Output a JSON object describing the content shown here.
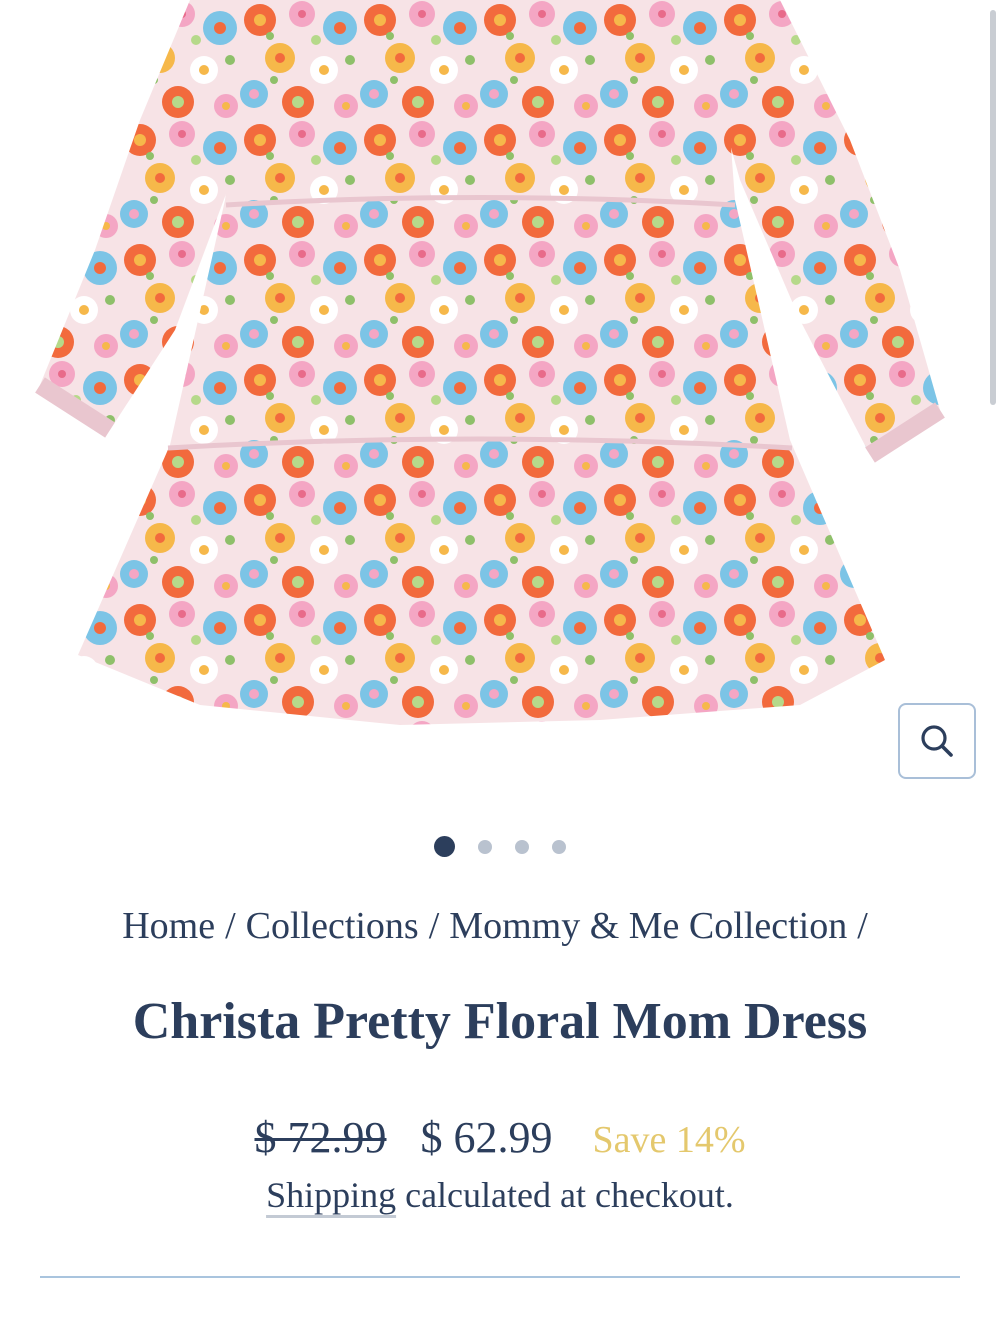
{
  "product": {
    "image_alt": "Christa Pretty Floral Mom Dress",
    "title": "Christa Pretty Floral Mom Dress",
    "price_compare": "$ 72.99",
    "price_sale": "$ 62.99",
    "save_label": "Save 14%"
  },
  "gallery": {
    "zoom_icon": "search-icon",
    "slide_count": 4,
    "active_slide": 1
  },
  "breadcrumb": {
    "items": [
      "Home",
      "Collections",
      "Mommy & Me Collection"
    ],
    "separator": "/"
  },
  "shipping": {
    "link_text": "Shipping",
    "rest_text": "calculated at checkout."
  },
  "colors": {
    "text_navy": "#2c3e5c",
    "save_gold": "#e4c86d",
    "divider_blue": "#a9c4de",
    "dress_orange": "#f26a3d",
    "dress_pink": "#f4a6c4",
    "dress_blue": "#7cc4e6",
    "dress_yellow": "#f6b84a"
  }
}
